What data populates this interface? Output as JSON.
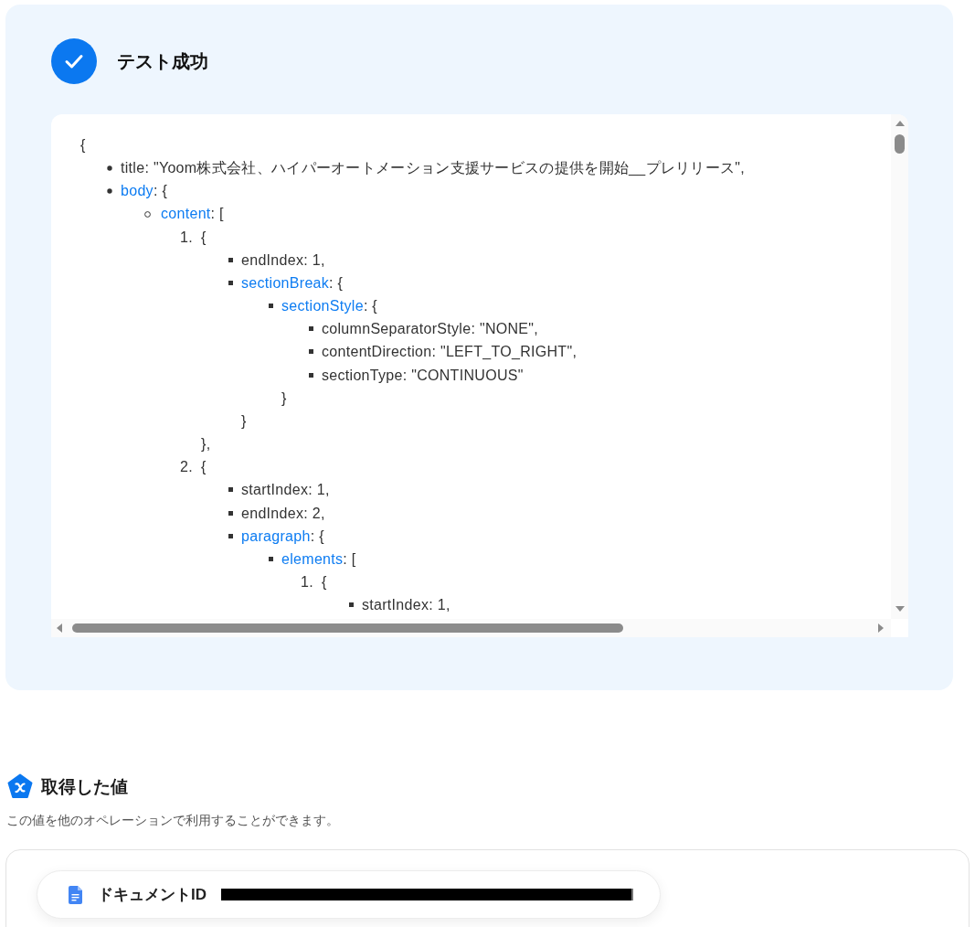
{
  "test_result": {
    "title": "テスト成功",
    "output": {
      "opening": "{",
      "entries": [
        {
          "kind": "field",
          "key": "title",
          "value": ": \"Yoom株式会社、ハイパーオートメーション支援サービスの提供を開始__プレリリース\","
        },
        {
          "kind": "object",
          "key": "body",
          "value": ": {",
          "children": [
            {
              "kind": "object",
              "key": "content",
              "value": ": [",
              "children": [
                {
                  "kind": "item",
                  "marker": "1.",
                  "value": "{",
                  "closing": "},",
                  "children": [
                    {
                      "kind": "field",
                      "key": "endIndex",
                      "value": ": 1,"
                    },
                    {
                      "kind": "object",
                      "key": "sectionBreak",
                      "value": ": {",
                      "closing": "}",
                      "children": [
                        {
                          "kind": "object",
                          "key": "sectionStyle",
                          "value": ": {",
                          "closing": "}",
                          "children": [
                            {
                              "kind": "field",
                              "key": "columnSeparatorStyle",
                              "value": ": \"NONE\","
                            },
                            {
                              "kind": "field",
                              "key": "contentDirection",
                              "value": ": \"LEFT_TO_RIGHT\","
                            },
                            {
                              "kind": "field",
                              "key": "sectionType",
                              "value": ": \"CONTINUOUS\""
                            }
                          ]
                        }
                      ]
                    }
                  ]
                },
                {
                  "kind": "item",
                  "marker": "2.",
                  "value": "{",
                  "children": [
                    {
                      "kind": "field",
                      "key": "startIndex",
                      "value": ": 1,"
                    },
                    {
                      "kind": "field",
                      "key": "endIndex",
                      "value": ": 2,"
                    },
                    {
                      "kind": "object",
                      "key": "paragraph",
                      "value": ": {",
                      "children": [
                        {
                          "kind": "object",
                          "key": "elements",
                          "value": ": [",
                          "children": [
                            {
                              "kind": "item",
                              "marker": "1.",
                              "value": "{",
                              "children": [
                                {
                                  "kind": "field",
                                  "key": "startIndex",
                                  "value": ": 1,"
                                }
                              ]
                            }
                          ]
                        }
                      ]
                    }
                  ]
                }
              ]
            }
          ]
        }
      ]
    }
  },
  "values_section": {
    "title": "取得した値",
    "description": "この値を他のオペレーションで利用することができます。",
    "fields": [
      {
        "label": "ドキュメントID",
        "redacted": true
      }
    ]
  }
}
